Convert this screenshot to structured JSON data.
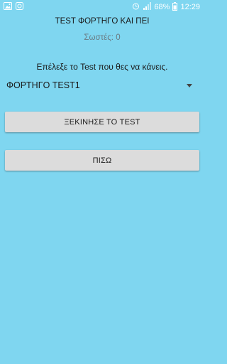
{
  "status_bar": {
    "icons_left": [
      "image-icon",
      "app-notification-icon"
    ],
    "battery_percent": "68%",
    "time": "12:29"
  },
  "screen": {
    "title": "TEST ΦΟΡΤΗΓΟ ΚΑΙ ΠΕΙ",
    "score": "Σωστές: 0",
    "prompt": "Επέλεξε το Test που θες να κάνεις.",
    "selected_test": "ΦΟΡΤΗΓΟ TEST1",
    "start_button": "ΞΕΚΙΝΗΣΕ ΤΟ TEST",
    "back_button": "ΠΙΣΩ"
  },
  "colors": {
    "background": "#7fd6f0",
    "button": "#dcdcdc"
  }
}
